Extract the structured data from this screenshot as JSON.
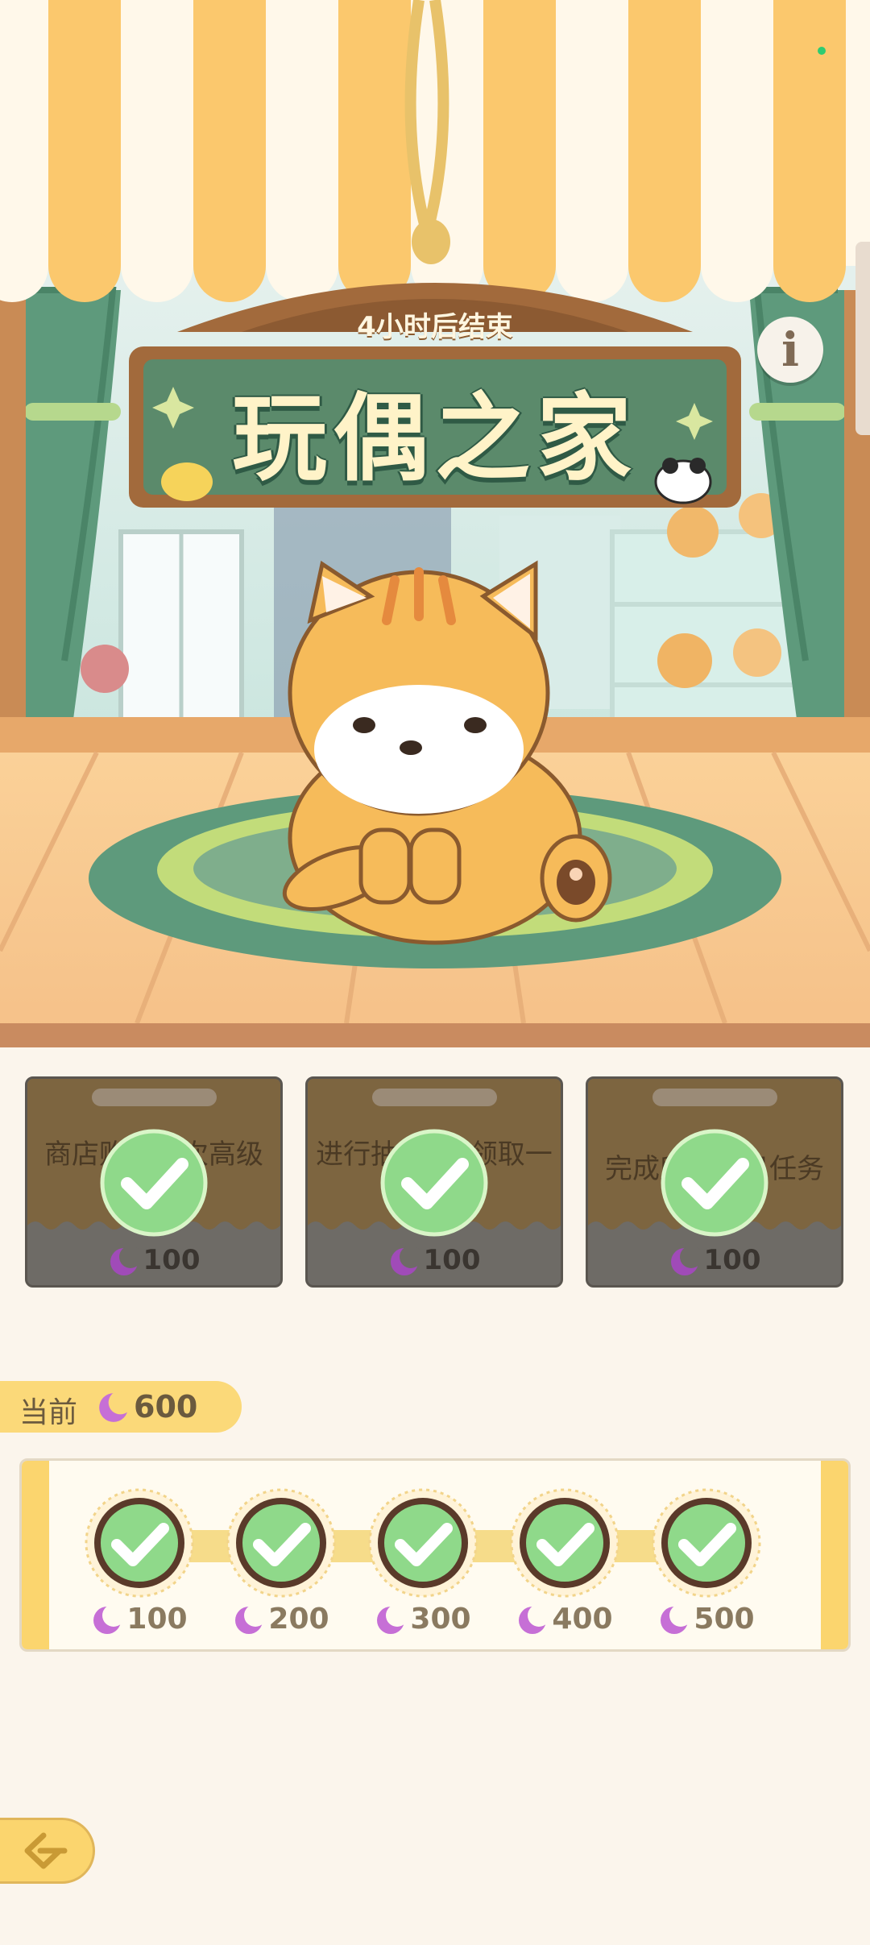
{
  "event": {
    "timer_text": "4小时后结束",
    "title": "玩偶之家",
    "info_glyph": "i"
  },
  "tasks": [
    {
      "description": "商店购买一次高级盲盒券",
      "reward": "100",
      "completed": true
    },
    {
      "description": "进行抽奖1次领取一",
      "reward": "100",
      "completed": true
    },
    {
      "description": "完成所有每日任务",
      "reward": "100",
      "completed": true
    }
  ],
  "currency": {
    "label": "当前",
    "value": "600",
    "icon": "crescent-moon-icon"
  },
  "milestones": [
    {
      "reward": "100",
      "claimed": true
    },
    {
      "reward": "200",
      "claimed": true
    },
    {
      "reward": "300",
      "claimed": true
    },
    {
      "reward": "400",
      "claimed": true
    },
    {
      "reward": "500",
      "claimed": true
    }
  ],
  "colors": {
    "accent_yellow": "#fbd56e",
    "check_green": "#8fd98a",
    "card_brown": "#7d6540",
    "moon_purple": "#a04bb8"
  },
  "back_icon": "back-arrow-icon"
}
